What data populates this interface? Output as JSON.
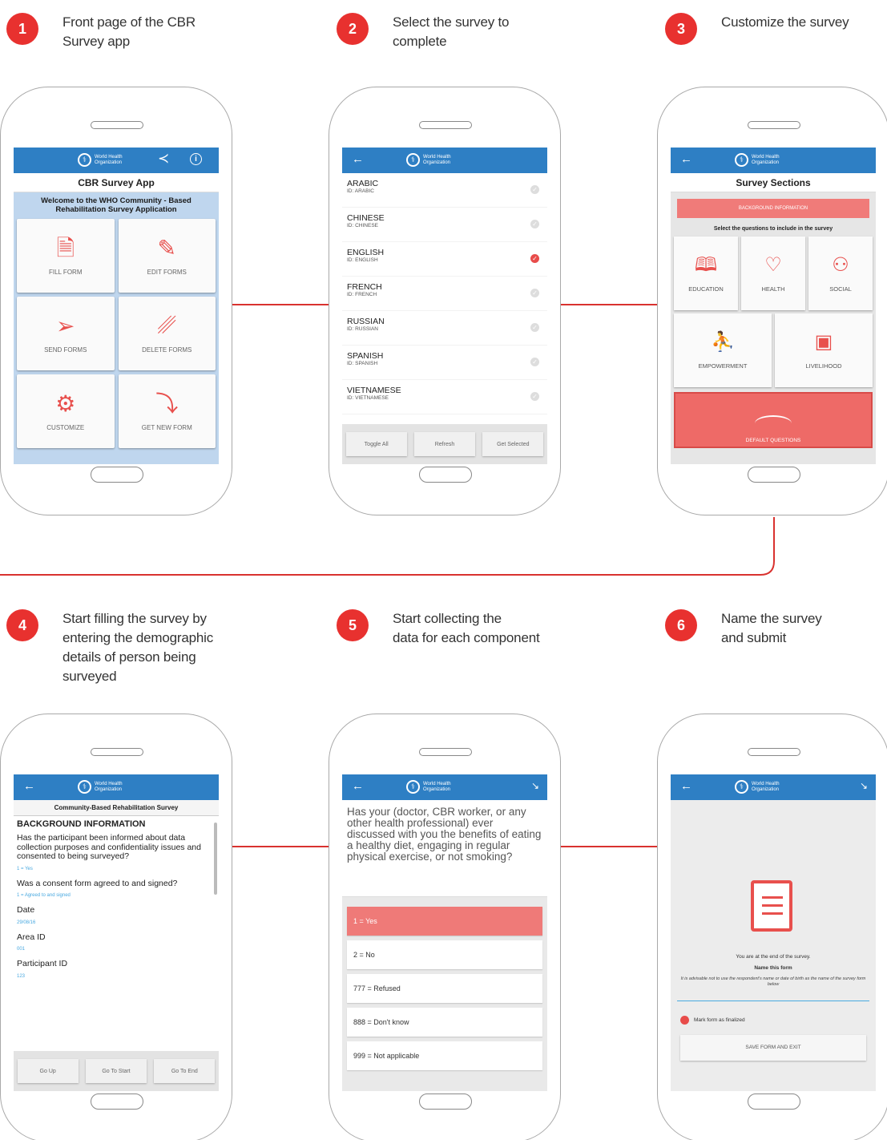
{
  "steps": [
    {
      "num": "1",
      "text": "Front page of the CBR\nSurvey app"
    },
    {
      "num": "2",
      "text": "Select the survey to\ncomplete"
    },
    {
      "num": "3",
      "text": "Customize the survey"
    },
    {
      "num": "4",
      "text": "Start filling the survey by\nentering the demographic\ndetails of person being\nsurveyed"
    },
    {
      "num": "5",
      "text": "Start collecting the\ndata for each component"
    },
    {
      "num": "6",
      "text": "Name the survey\nand submit"
    }
  ],
  "who_logo": {
    "line1": "World Health",
    "line2": "Organization"
  },
  "screen1": {
    "title": "CBR Survey App",
    "welcome": "Welcome to the WHO Community - Based Rehabilitation Survey Application",
    "tiles": [
      {
        "label": "FILL FORM",
        "icon": "document-icon",
        "glyph": "🗎"
      },
      {
        "label": "EDIT FORMS",
        "icon": "pencil-icon",
        "glyph": "✎"
      },
      {
        "label": "SEND FORMS",
        "icon": "paper-plane-icon",
        "glyph": "➢"
      },
      {
        "label": "DELETE FORMS",
        "icon": "trash-icon",
        "glyph": "␥"
      },
      {
        "label": "CUSTOMIZE",
        "icon": "gear-icon",
        "glyph": "⚙"
      },
      {
        "label": "GET NEW FORM",
        "icon": "download-arrow-icon",
        "glyph": "⤵"
      }
    ]
  },
  "screen2": {
    "languages": [
      {
        "name": "ARABIC",
        "id": "ID: ARABIC",
        "selected": false
      },
      {
        "name": "CHINESE",
        "id": "ID: CHINESE",
        "selected": false
      },
      {
        "name": "ENGLISH",
        "id": "ID: ENGLISH",
        "selected": true
      },
      {
        "name": "FRENCH",
        "id": "ID: FRENCH",
        "selected": false
      },
      {
        "name": "RUSSIAN",
        "id": "ID: RUSSIAN",
        "selected": false
      },
      {
        "name": "SPANISH",
        "id": "ID: SPANISH",
        "selected": false
      },
      {
        "name": "VIETNAMESE",
        "id": "ID: VIETNAMESE",
        "selected": false
      }
    ],
    "buttons": [
      "Toggle All",
      "Refresh",
      "Get Selected"
    ]
  },
  "screen3": {
    "title": "Survey Sections",
    "background_button": "BACKGROUND INFORMATION",
    "instruction": "Select the questions to include in the survey",
    "sections_row1": [
      {
        "label": "EDUCATION",
        "icon": "book-icon",
        "glyph": "🕮"
      },
      {
        "label": "HEALTH",
        "icon": "heart-icon",
        "glyph": "♡"
      },
      {
        "label": "SOCIAL",
        "icon": "people-icon",
        "glyph": "⚇"
      }
    ],
    "sections_row2": [
      {
        "label": "EMPOWERMENT",
        "icon": "person-climbing-icon",
        "glyph": "⛹"
      },
      {
        "label": "LIVELIHOOD",
        "icon": "briefcase-icon",
        "glyph": "▣"
      }
    ],
    "default_button": "DEFAULT QUESTIONS"
  },
  "screen4": {
    "title": "Community-Based Rehabilitation Survey",
    "section": "BACKGROUND INFORMATION",
    "questions": [
      {
        "q": "Has the participant been informed about data collection purposes and confidentiality issues and consented to being surveyed?",
        "a": "1 = Yes"
      },
      {
        "q": "Was a consent form agreed to and signed?",
        "a": "1 = Agreed to and signed"
      },
      {
        "q": "Date",
        "a": "29/08/16"
      },
      {
        "q": "Area ID",
        "a": "001"
      },
      {
        "q": "Participant ID",
        "a": "123"
      }
    ],
    "buttons": [
      "Go Up",
      "Go To Start",
      "Go To End"
    ]
  },
  "screen5": {
    "question": "Has your (doctor, CBR worker, or any other health professional) ever discussed with you the benefits of eating a healthy diet, engaging in regular physical exercise, or not smoking?",
    "options": [
      {
        "label": "1 = Yes",
        "selected": true
      },
      {
        "label": "2 = No",
        "selected": false
      },
      {
        "label": "777 = Refused",
        "selected": false
      },
      {
        "label": "888 = Don't know",
        "selected": false
      },
      {
        "label": "999 = Not applicable",
        "selected": false
      }
    ]
  },
  "screen6": {
    "end_text": "You are at the end of the survey.",
    "name_label": "Name this form",
    "advice": "It is advisable not to use the respondent's name or date of birth as the name of the survey form below",
    "finalize_label": "Mark form as finalized",
    "save_button": "SAVE FORM AND EXIT"
  },
  "colors": {
    "accent": "#e8312f",
    "appbar": "#2e7fc4",
    "highlight": "#ef7a78"
  }
}
